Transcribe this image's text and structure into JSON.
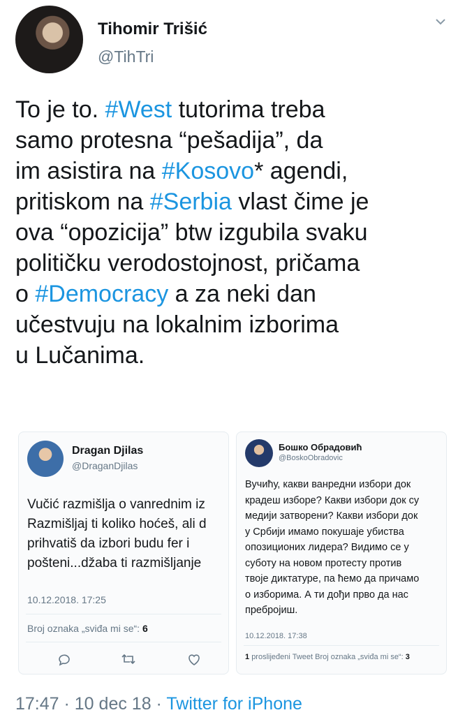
{
  "author": {
    "name": "Tihomir Trišić",
    "handle": "@TihTri"
  },
  "tweet": {
    "segments": [
      {
        "text": "To je to. ",
        "hashtag": false
      },
      {
        "text": "#West",
        "hashtag": true
      },
      {
        "text": " tutorima treba\nsamo protesna “pešadija”, da\nim asistira na ",
        "hashtag": false
      },
      {
        "text": "#Kosovo",
        "hashtag": true
      },
      {
        "text": "* agendi,\npritiskom na ",
        "hashtag": false
      },
      {
        "text": "#Serbia",
        "hashtag": true
      },
      {
        "text": " vlast čime je\nova “opozicija” btw izgubila svaku\npolitičku verodostojnost, pričama\no ",
        "hashtag": false
      },
      {
        "text": "#Democracy",
        "hashtag": true
      },
      {
        "text": " a za neki dan\nučestvuju na lokalnim izborima\nu Lučanima.",
        "hashtag": false
      }
    ]
  },
  "embedded_left": {
    "name": "Dragan Djilas",
    "handle": "@DraganDjilas",
    "lines": [
      "Vučić razmišlja o vanrednim iz",
      "Razmišljaj ti koliko hoćeš, ali d",
      "prihvatiš da izbori budu fer i",
      "pošteni...džaba ti razmišljanje"
    ],
    "date": "10.12.2018. 17:25",
    "likes_label": "Broj oznaka „sviđa mi se“:",
    "likes_count": "6"
  },
  "embedded_right": {
    "name": "Бошко Обрадовић",
    "handle": "@BoskoObradovic",
    "lines": [
      "Вучићу, какви ванредни избори док",
      "крадеш изборе? Какви избори док су",
      "медији затворени? Какви избори док",
      "у Србији имамо покушаје убиства",
      "опозиционих лидера? Видимо се у",
      "суботу на новом протесту против",
      "твоје диктатуре, па ћемо да причамо",
      "о изборима. А ти дођи прво да нас",
      "пребројиш."
    ],
    "date": "10.12.2018. 17:38",
    "retweets_count": "1",
    "retweets_label": "proslijeđeni Tweet",
    "likes_label": "Broj oznaka „sviđa mi se“:",
    "likes_count": "3"
  },
  "footer": {
    "time": "17:47",
    "dot1": " · ",
    "date": "10 dec 18",
    "dot2": " · ",
    "app": "Twitter for iPhone"
  },
  "colors": {
    "link": "#1b95e0",
    "secondary": "#657786",
    "text": "#14171a"
  },
  "icons": [
    "chevron-down-icon",
    "reply-icon",
    "retweet-icon",
    "like-icon"
  ]
}
